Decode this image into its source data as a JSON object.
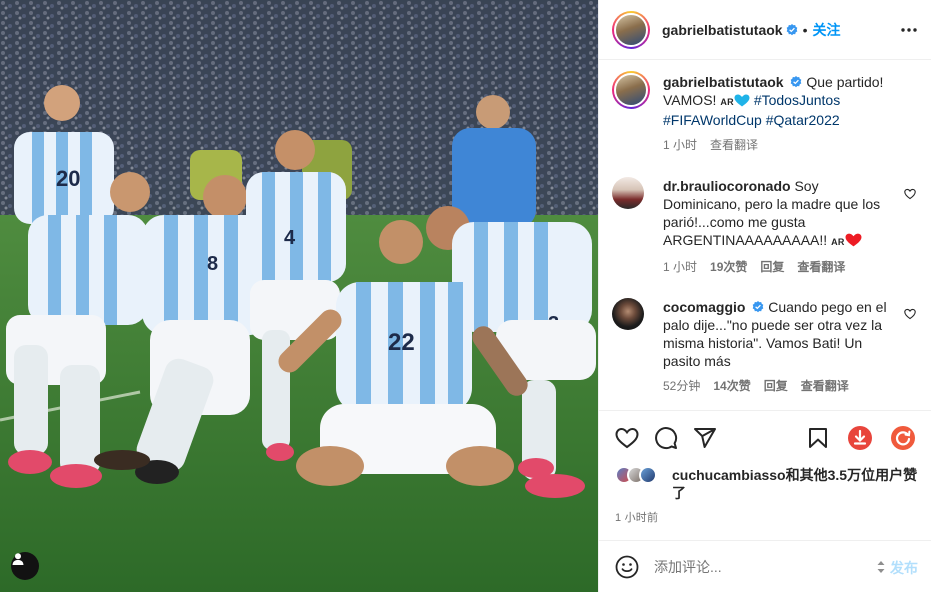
{
  "photo": {
    "tag_icon": "person-tag-icon",
    "jersey_numbers": [
      "20",
      "8",
      "4",
      "22",
      "3"
    ]
  },
  "header": {
    "username": "gabrielbatistutaok",
    "separator": "•",
    "follow_label": "关注",
    "more_icon": "more-horizontal-icon"
  },
  "caption": {
    "username": "gabrielbatistutaok",
    "text_1": "Que partido! VAMOS!",
    "flag": "AR",
    "hashtags": [
      "#TodosJuntos",
      "#FIFAWorldCup",
      "#Qatar2022"
    ],
    "time": "1 小时",
    "translate": "查看翻译"
  },
  "comments": [
    {
      "username": "dr.brauliocoronado",
      "text": "Soy Dominicano, pero la madre que los parió!...como me gusta ARGENTINAAAAAAAAA!!",
      "flag": "AR",
      "time": "1 小时",
      "likes": "19次赞",
      "reply": "回复",
      "translate": "查看翻译"
    },
    {
      "username": "cocomaggio",
      "text": "Cuando pego en el palo dije...\"no puede ser otra vez la misma historia\". Vamos Bati! Un pasito más",
      "time": "52分钟",
      "likes": "14次赞",
      "reply": "回复",
      "translate": "查看翻译"
    }
  ],
  "actions": {
    "icons": [
      "heart-icon",
      "comment-icon",
      "share-icon",
      "save-icon",
      "download-icon",
      "refresh-icon"
    ]
  },
  "likes": {
    "user": "cuchucambiasso",
    "rest": "和其他3.5万位用户赞了"
  },
  "timestamp": "1 小时前",
  "composer": {
    "placeholder": "添加评论...",
    "post_label": "发布"
  },
  "colors": {
    "accent": "#0095f6",
    "verified": "#3897f0",
    "hashtag": "#00376b",
    "muted": "#737373",
    "heart_red": "#ed1c24",
    "heart_blue": "#1fb3e8"
  }
}
